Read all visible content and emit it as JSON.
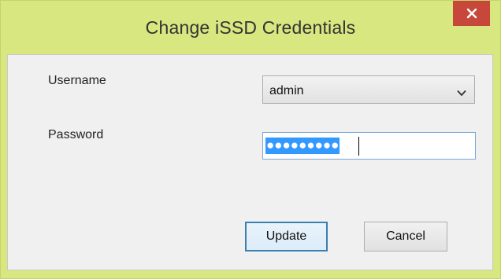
{
  "window": {
    "title": "Change iSSD Credentials",
    "close_icon": "close-icon",
    "accent_color": "#d8e77f",
    "close_color": "#c7483b"
  },
  "form": {
    "username_label": "Username",
    "username_value": "admin",
    "password_label": "Password",
    "password_masked": "●●●●●●●●●"
  },
  "buttons": {
    "update_label": "Update",
    "cancel_label": "Cancel"
  }
}
